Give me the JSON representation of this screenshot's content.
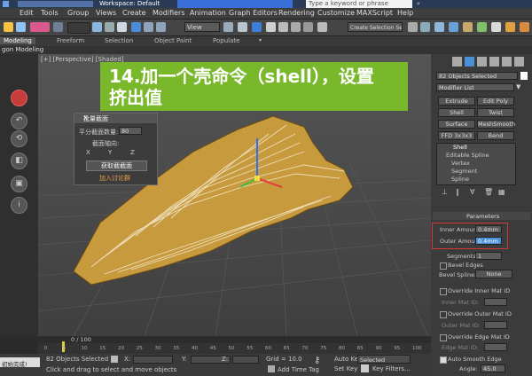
{
  "titlebar": {
    "workspace": "Workspace: Default",
    "search_placeholder": "Type a keyword or phrase"
  },
  "menu": [
    "Edit",
    "Tools",
    "Group",
    "Views",
    "Create",
    "Modifiers",
    "Animation",
    "Graph Editors",
    "Rendering",
    "Customize",
    "MAXScript",
    "Help"
  ],
  "toolbar": {
    "view_select": "View",
    "selection_set": "Create Selection Set"
  },
  "ribbon": {
    "tabs": [
      "Modeling",
      "Freeform",
      "Selection",
      "Object Paint",
      "Populate"
    ],
    "subtab": "gon Modeling"
  },
  "viewport": {
    "label": "[+] [Perspective] [Shaded]"
  },
  "banner": {
    "line1": "14.加一个壳命令（shell），设置",
    "line2": "挤出值"
  },
  "dialog": {
    "title": "批量截面",
    "close": "X",
    "count_label": "平分截面数量:",
    "count_value": "80",
    "axis_label": "截面轴向:",
    "axes": [
      "X",
      "Y",
      "Z"
    ],
    "get_button": "获取截截面",
    "add_link": "加入讨论群"
  },
  "panel": {
    "objects_selected": "82 Objects Selected",
    "modifier_list": "Modifier List",
    "buttons": [
      "Extrude",
      "Edit Poly",
      "Shell",
      "Twist",
      "Surface",
      "MeshSmooth",
      "FFD 3x3x3",
      "Bend"
    ],
    "stack": [
      "Shell",
      "Editable Spline",
      "Vertex",
      "Segment",
      "Spline"
    ],
    "rollout_title": "Parameters",
    "inner_amount_label": "Inner Amount:",
    "inner_amount_value": "0.4mm",
    "outer_amount_label": "Outer Amount:",
    "outer_amount_value": "0.4mm",
    "segments_label": "Segments:",
    "segments_value": "1",
    "bevel_edges": "Bevel Edges",
    "bevel_spline_label": "Bevel Spline:",
    "bevel_spline_value": "None",
    "override_inner": "Override Inner Mat ID",
    "inner_mat_label": "Inner Mat ID:",
    "override_outer": "Override Outer Mat ID",
    "outer_mat_label": "Outer Mat ID:",
    "override_edge": "Override Edge Mat ID",
    "edge_mat_label": "Edge Mat ID:",
    "auto_smooth": "Auto Smooth Edge",
    "angle_label": "Angle:",
    "angle_value": "45.0"
  },
  "timeline": {
    "frame": "0 / 100",
    "ticks": [
      "0",
      "5",
      "10",
      "15",
      "20",
      "25",
      "30",
      "35",
      "40",
      "45",
      "50",
      "55",
      "60",
      "65",
      "70",
      "75",
      "80",
      "85",
      "90",
      "95",
      "100"
    ]
  },
  "status": {
    "selected": "82 Objects Selected",
    "prompt": "Click and drag to select and move objects",
    "left_msg": "初始完成!",
    "x_label": "X:",
    "y_label": "Y:",
    "z_label": "Z:",
    "grid": "Grid = 10.0",
    "add_time_tag": "Add Time Tag",
    "auto_key": "Auto Key",
    "set_key": "Set Key",
    "key_mode": "Selected",
    "key_filters": "Key Filters..."
  },
  "colors": {
    "banner": "#79b82b",
    "accent_blue": "#4aa3ff",
    "model": "#c79a3d",
    "highlight": "#d23a3a"
  }
}
